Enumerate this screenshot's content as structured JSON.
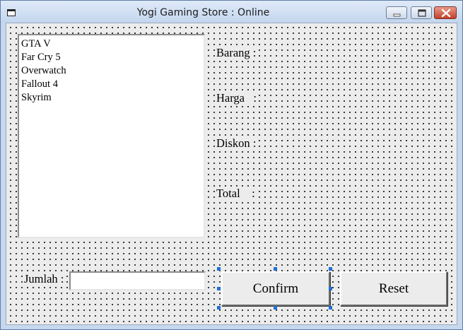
{
  "window": {
    "title": "Yogi Gaming Store : Online"
  },
  "games_list": [
    "GTA V",
    "Far Cry 5",
    "Overwatch",
    "Fallout 4",
    "Skyrim"
  ],
  "labels": {
    "barang": "Barang :",
    "harga": "Harga   :",
    "diskon": "Diskon :",
    "total": "Total    :",
    "jumlah": "Jumlah :"
  },
  "inputs": {
    "jumlah_value": ""
  },
  "buttons": {
    "confirm": "Confirm",
    "reset": "Reset"
  },
  "icons": {
    "app": "app-window-icon",
    "minimize": "minimize-icon",
    "maximize": "maximize-icon",
    "close": "close-icon"
  },
  "colors": {
    "close_button": "#c2412b",
    "selection_handle": "#1e6fd6"
  }
}
